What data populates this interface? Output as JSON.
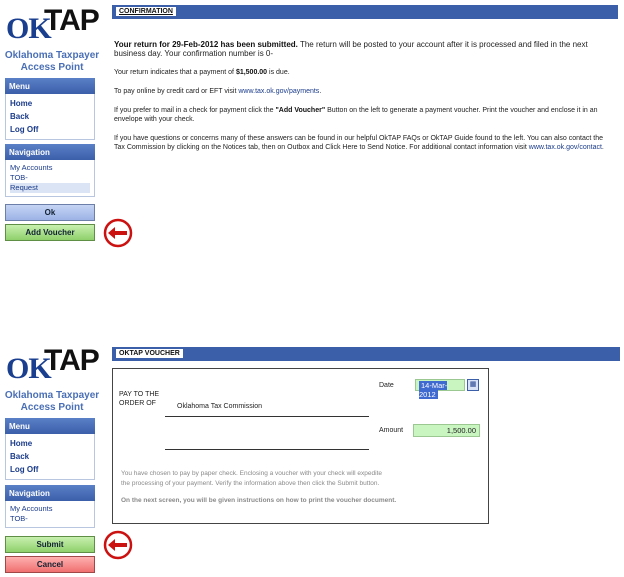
{
  "logo": {
    "ok": "OK",
    "tap": "TAP",
    "line1": "Oklahoma Taxpayer",
    "line2": "Access Point"
  },
  "sidebar": {
    "menu_title": "Menu",
    "menu_items": [
      "Home",
      "Back",
      "Log Off"
    ],
    "nav_title": "Navigation",
    "nav_items_top": [
      "My Accounts",
      "TOB-",
      "Request"
    ],
    "nav_items_bottom": [
      "My Accounts",
      "TOB-"
    ]
  },
  "buttons": {
    "ok": "Ok",
    "add_voucher": "Add Voucher",
    "submit": "Submit",
    "cancel": "Cancel"
  },
  "confirmation": {
    "tab": "CONFIRMATION",
    "p1_bold": "Your return for 29-Feb-2012 has been submitted.",
    "p1_rest": " The return will be posted to your account after it is processed and filed in the next business day. Your confirmation number is 0-",
    "p2_pre": "Your return indicates that a payment of ",
    "p2_amount": "$1,500.00",
    "p2_post": " is due.",
    "p3_pre": "To pay online by credit card or EFT visit ",
    "p3_link": "www.tax.ok.gov/payments",
    "p3_post": ".",
    "p4_pre": "If you prefer to mail in a check for payment click the ",
    "p4_bold": "\"Add Voucher\"",
    "p4_post": " Button on the left to generate a payment voucher. Print the voucher and enclose it in an envelope with your check.",
    "p5_pre": "If you have questions or concerns many of these answers can be found in our helpful OkTAP FAQs or OkTAP Guide found to the left. You can also contact the Tax Commission by clicking on the Notices tab, then on Outbox and Click Here to Send Notice. For additional contact information visit ",
    "p5_link": "www.tax.ok.gov/contact",
    "p5_post": "."
  },
  "voucher": {
    "tab": "OKTAP VOUCHER",
    "pay_to_line1": "PAY TO THE",
    "pay_to_line2": "ORDER OF",
    "payee": "Oklahoma Tax Commission",
    "date_label": "Date",
    "date_value": "14-Mar-2012",
    "amount_label": "Amount",
    "amount_value": "1,500.00",
    "note1": "You have chosen to pay by paper check. Enclosing a voucher with your check will expedite",
    "note2": "the processing of your payment. Verify the information above then click the Submit button.",
    "note3": "On the next screen, you will be given instructions on how to print the voucher document."
  },
  "colors": {
    "header_blue": "#3b5fa8",
    "annotation_red": "#cc1111",
    "field_green": "#c8f5c0"
  }
}
